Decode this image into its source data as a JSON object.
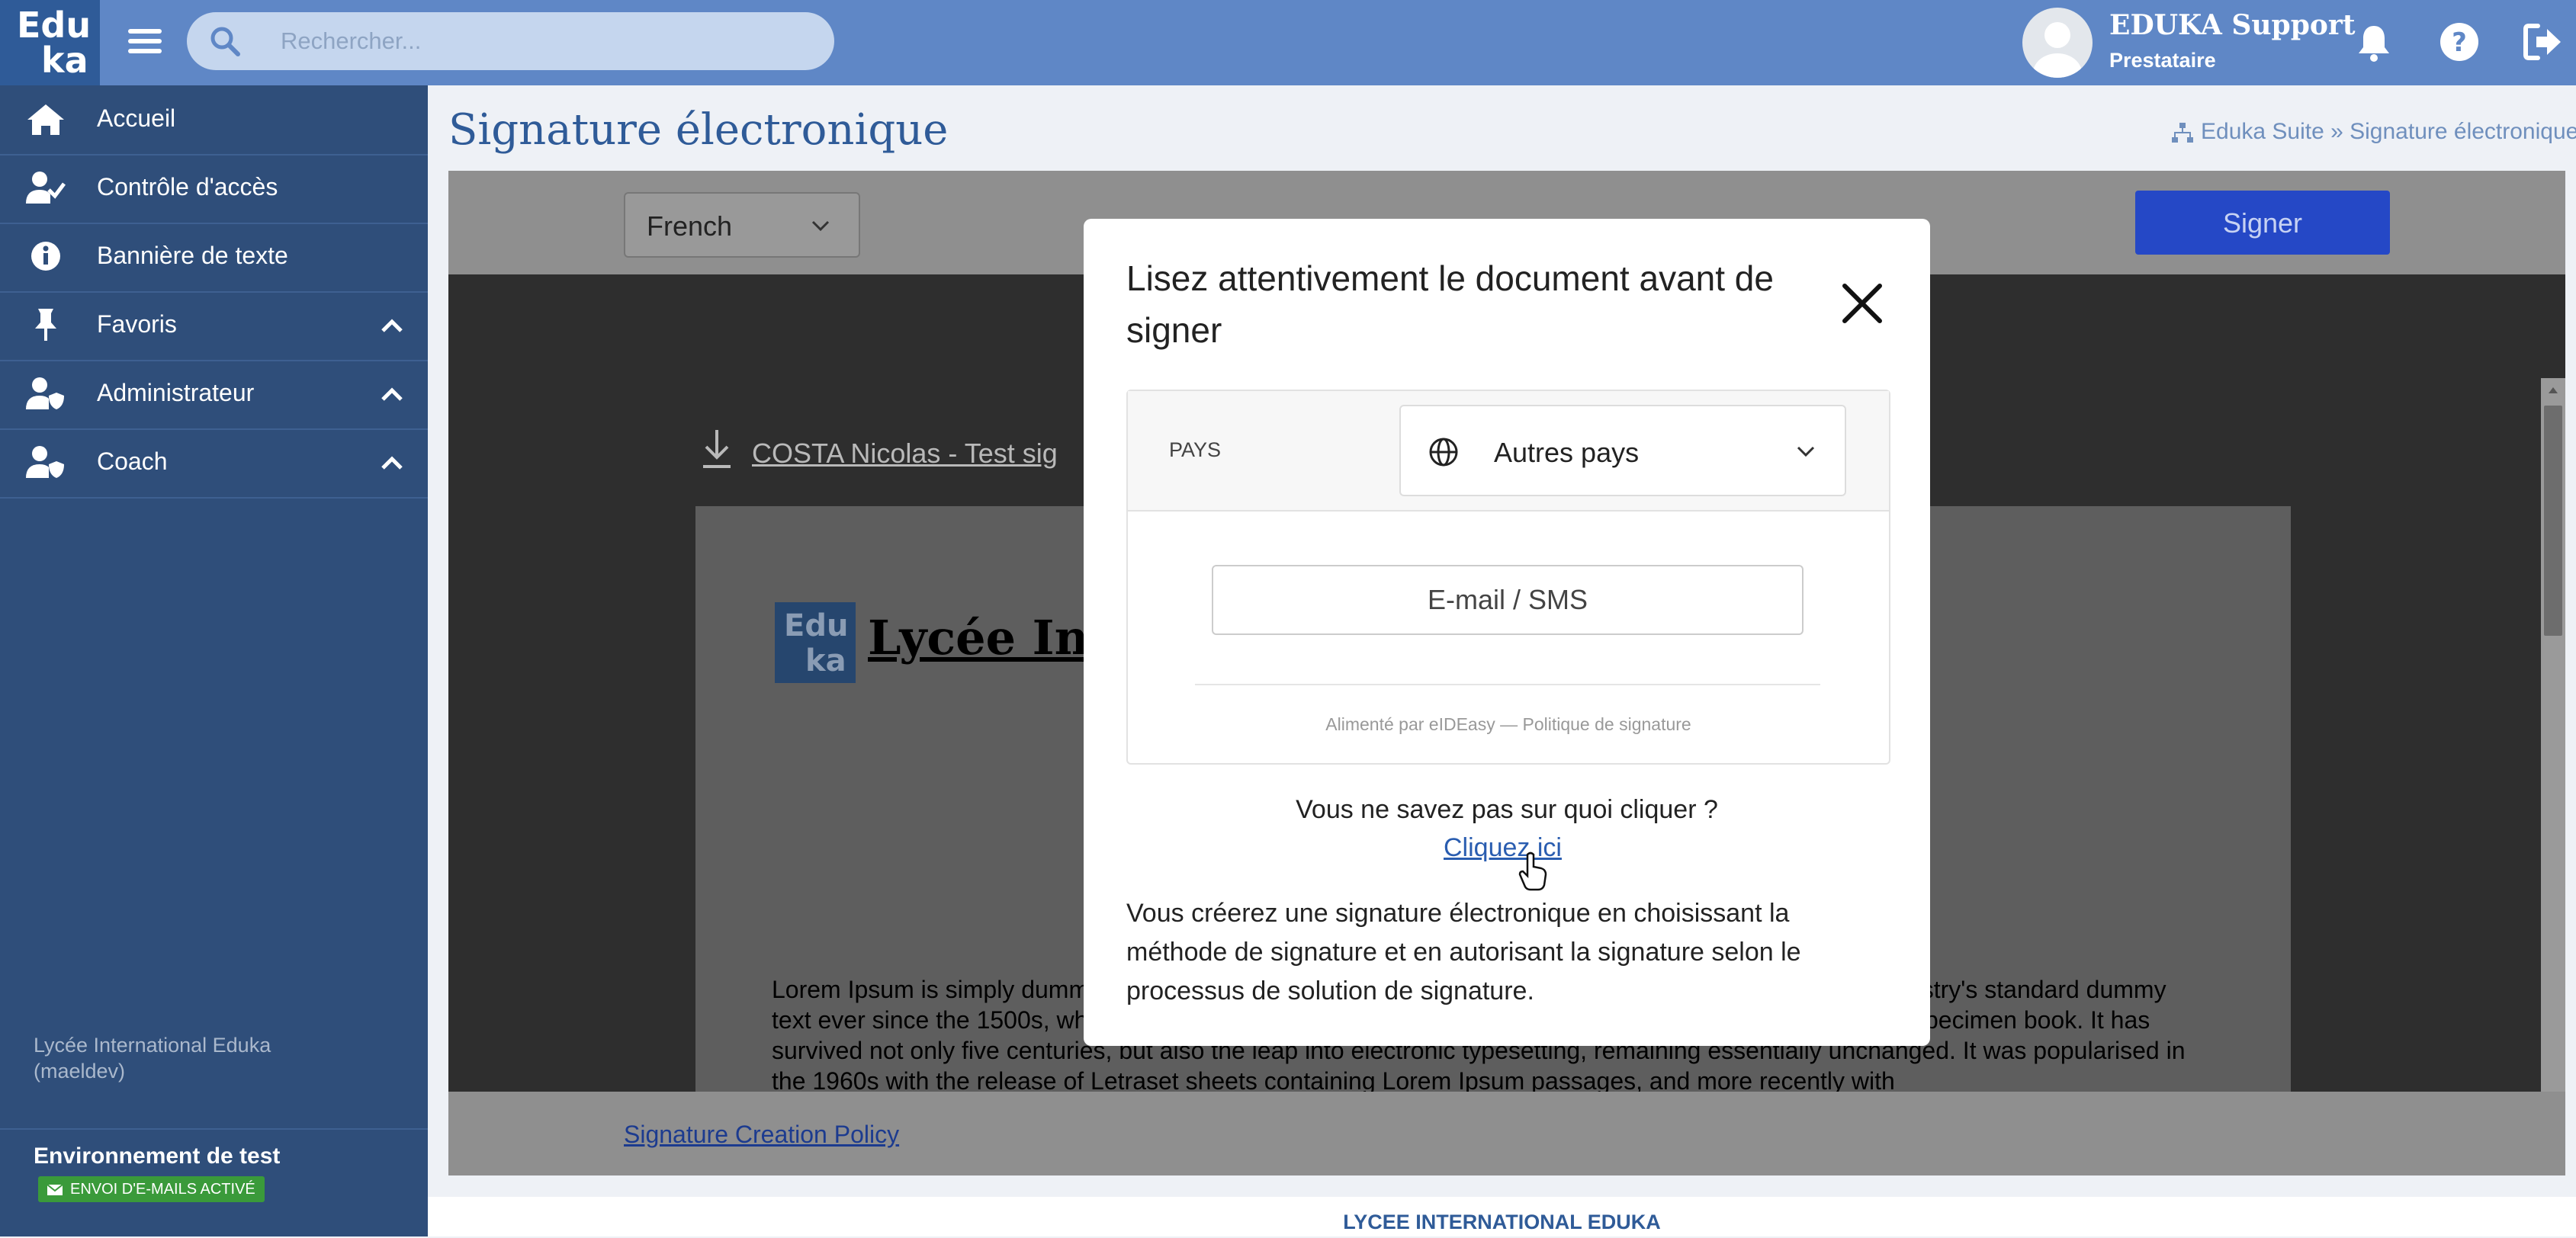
{
  "app": {
    "logo_line1": "Edu",
    "logo_line2": "ka"
  },
  "search": {
    "placeholder": "Rechercher..."
  },
  "user": {
    "name": "EDUKA Support",
    "role": "Prestataire"
  },
  "sidebar": {
    "items": [
      {
        "label": "Accueil",
        "icon": "home-icon"
      },
      {
        "label": "Contrôle d'accès",
        "icon": "user-check-icon"
      },
      {
        "label": "Bannière de texte",
        "icon": "info-icon"
      },
      {
        "label": "Favoris",
        "icon": "pin-icon",
        "expandable": true
      },
      {
        "label": "Administrateur",
        "icon": "user-shield-icon",
        "expandable": true
      },
      {
        "label": "Coach",
        "icon": "user-shield-icon",
        "expandable": true
      }
    ],
    "org_line1": "Lycée International Eduka",
    "org_line2": "(maeldev)",
    "env_title": "Environnement de test",
    "env_badge": "ENVOI D'E-MAILS ACTIVÉ"
  },
  "page": {
    "title": "Signature électronique",
    "breadcrumb": "Eduka Suite » Signature électronique"
  },
  "viewer": {
    "language": "French",
    "sign_label": "Signer",
    "download_link": "COSTA Nicolas - Test sig",
    "doc_logo_line1": "Edu",
    "doc_logo_line2": "ka",
    "doc_school": "Lycée Inte",
    "lorem": "Lorem Ipsum is simply dummy text of the printing and typesetting industry. Lorem Ipsum has been the industry's standard dummy text ever since the 1500s, when an unknown printer took a galley of type and scrambled it to make a type specimen book. It has survived not only five centuries, but also the leap into electronic typesetting, remaining essentially unchanged. It was popularised in the 1960s with the release of Letraset sheets containing Lorem Ipsum passages, and more recently with",
    "policy_link": "Signature Creation Policy"
  },
  "modal": {
    "title": "Lisez attentivement le document avant de signer",
    "country_label": "PAYS",
    "country_value": "Autres pays",
    "email_placeholder": "E-mail / SMS",
    "powered_by": "Alimenté par eIDEasy  —  Politique de signature",
    "question": "Vous ne savez pas sur quoi cliquer ?",
    "click_here": "Cliquez ici",
    "description": "Vous créerez une signature électronique en choisissant la méthode de signature et en autorisant la signature selon le processus de solution de signature."
  },
  "footer": {
    "text": "LYCEE INTERNATIONAL EDUKA"
  },
  "colors": {
    "topbar": "#5f87c6",
    "sidebar": "#2f4e7a",
    "accent": "#2f5b98",
    "sign_button": "#2548c6",
    "badge": "#3a9a3a"
  }
}
